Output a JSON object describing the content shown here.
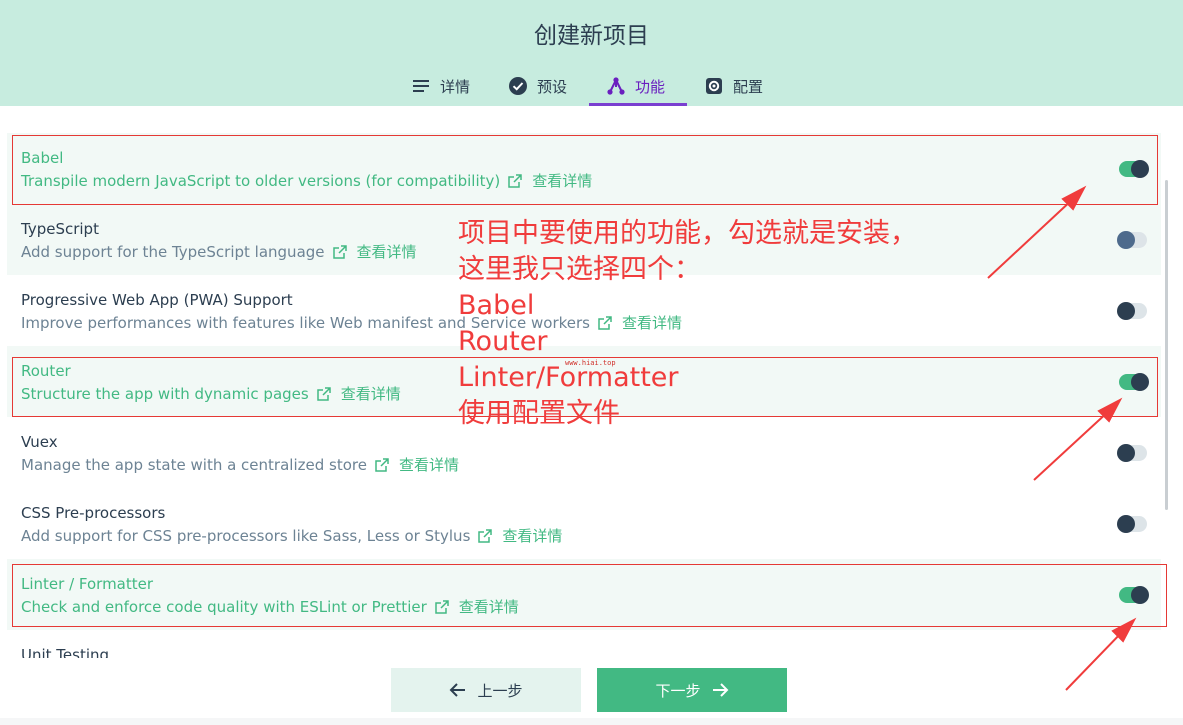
{
  "header": {
    "title": "创建新项目",
    "tabs": [
      {
        "label": "详情",
        "icon": "list-icon"
      },
      {
        "label": "预设",
        "icon": "check-circle-icon"
      },
      {
        "label": "功能",
        "icon": "fork-icon",
        "active": true
      },
      {
        "label": "配置",
        "icon": "gear-icon"
      }
    ]
  },
  "features": [
    {
      "name": "Babel",
      "desc": "Transpile modern JavaScript to older versions (for compatibility)",
      "more": "查看详情",
      "enabled": true
    },
    {
      "name": "TypeScript",
      "desc": "Add support for the TypeScript language",
      "more": "查看详情",
      "enabled": false
    },
    {
      "name": "Progressive Web App (PWA) Support",
      "desc": "Improve performances with features like Web manifest and Service workers",
      "more": "查看详情",
      "enabled": false
    },
    {
      "name": "Router",
      "desc": "Structure the app with dynamic pages",
      "more": "查看详情",
      "enabled": true
    },
    {
      "name": "Vuex",
      "desc": "Manage the app state with a centralized store",
      "more": "查看详情",
      "enabled": false
    },
    {
      "name": "CSS Pre-processors",
      "desc": "Add support for CSS pre-processors like Sass, Less or Stylus",
      "more": "查看详情",
      "enabled": false
    },
    {
      "name": "Linter / Formatter",
      "desc": "Check and enforce code quality with ESLint or Prettier",
      "more": "查看详情",
      "enabled": true
    }
  ],
  "partial_item": "Unit Testing",
  "annotation": {
    "lines": [
      "项目中要使用的功能，勾选就是安装，",
      "这里我只选择四个：",
      "Babel",
      "Router",
      "Linter/Formatter",
      "使用配置文件"
    ],
    "watermark": "www.hiai.top"
  },
  "footer": {
    "prev_label": "上一步",
    "next_label": "下一步"
  },
  "colors": {
    "header_bg": "#c7ecdf",
    "accent_green": "#42b983",
    "active_tab": "#6a1fbf",
    "annotation_red": "#f03c3c"
  }
}
